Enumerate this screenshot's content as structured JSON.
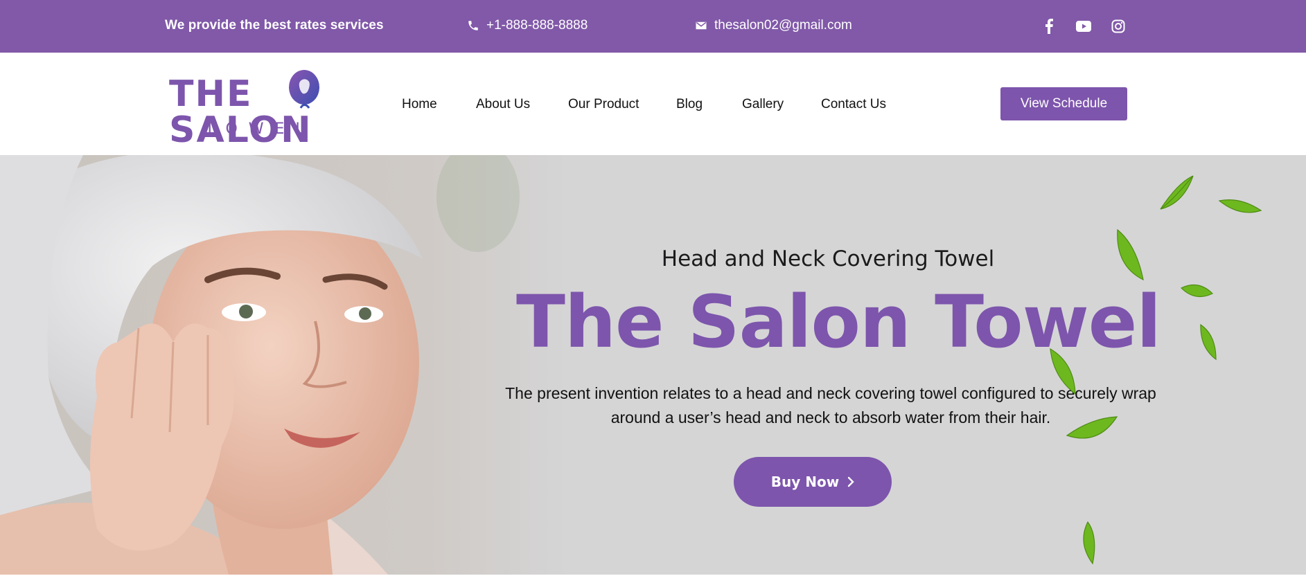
{
  "topbar": {
    "tagline": "We provide the best rates services",
    "phone": "+1-888-888-8888",
    "email": "thesalon02@gmail.com",
    "social": [
      "facebook-icon",
      "youtube-icon",
      "instagram-icon"
    ],
    "background_color": "#8159a8"
  },
  "header": {
    "logo": {
      "main": "THE SALON",
      "sub": "TOWEL"
    },
    "nav": [
      "Home",
      "About Us",
      "Our Product",
      "Blog",
      "Gallery",
      "Contact Us"
    ],
    "cta_label": "View Schedule",
    "accent_color": "#7d55ac"
  },
  "hero": {
    "subtitle": "Head and Neck Covering Towel",
    "title": "The Salon Towel",
    "description_line1": "The present invention relates to a head and neck covering towel configured to securely wrap",
    "description_line2": "around a user’s head and neck to absorb water from their hair.",
    "button_label": "Buy Now",
    "button_icon": "chevron-right-icon"
  }
}
